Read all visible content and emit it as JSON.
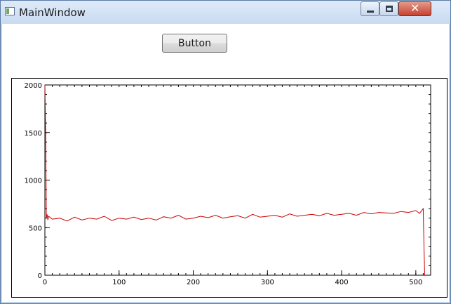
{
  "window": {
    "title": "MainWindow"
  },
  "main": {
    "button_label": "Button"
  },
  "chart_data": {
    "type": "line",
    "title": "",
    "xlabel": "",
    "ylabel": "",
    "xlim": [
      0,
      520
    ],
    "ylim": [
      0,
      2000
    ],
    "x_ticks": [
      0,
      100,
      200,
      300,
      400,
      500
    ],
    "y_ticks": [
      0,
      500,
      1000,
      1500,
      2000
    ],
    "grid": false,
    "legend": "none",
    "line_color": "#cc0000",
    "series": [
      {
        "x": [
          0,
          1,
          2,
          3,
          4,
          5,
          10,
          20,
          30,
          40,
          50,
          60,
          70,
          80,
          90,
          100,
          110,
          120,
          130,
          140,
          150,
          160,
          170,
          180,
          190,
          200,
          210,
          220,
          230,
          240,
          250,
          260,
          270,
          280,
          290,
          300,
          310,
          320,
          330,
          340,
          350,
          360,
          370,
          380,
          390,
          400,
          410,
          420,
          430,
          440,
          450,
          460,
          470,
          480,
          490,
          500,
          505,
          510,
          511,
          512
        ],
        "y": [
          2000,
          1500,
          600,
          640,
          580,
          620,
          590,
          600,
          570,
          610,
          580,
          600,
          590,
          620,
          575,
          600,
          590,
          610,
          585,
          600,
          580,
          615,
          600,
          630,
          590,
          600,
          620,
          605,
          630,
          600,
          615,
          625,
          600,
          640,
          610,
          620,
          630,
          610,
          645,
          620,
          630,
          640,
          625,
          650,
          630,
          640,
          650,
          630,
          660,
          645,
          660,
          655,
          650,
          670,
          660,
          680,
          650,
          700,
          300,
          0
        ]
      }
    ]
  }
}
